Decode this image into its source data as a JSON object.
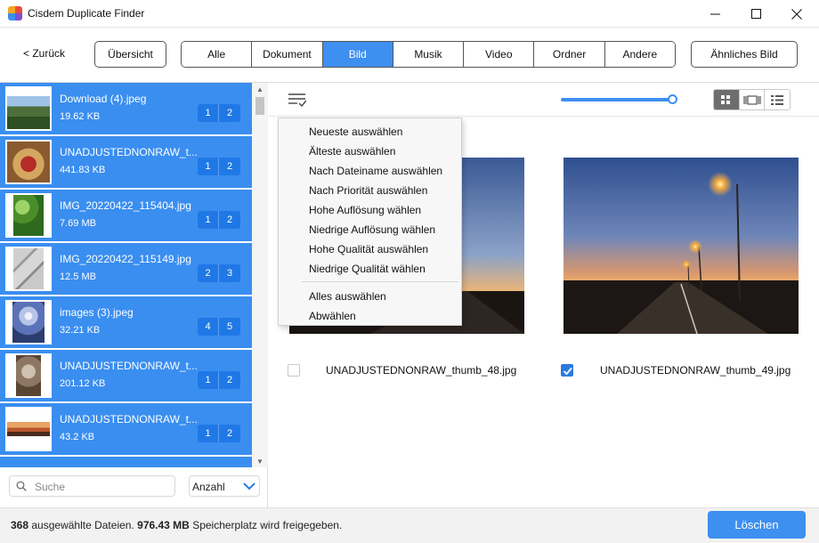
{
  "window": {
    "title": "Cisdem Duplicate Finder",
    "minimize_icon": "minimize-icon",
    "maximize_icon": "maximize-icon",
    "close_icon": "close-icon"
  },
  "toolbar": {
    "back_label": "< Zurück",
    "overview_label": "Übersicht",
    "similar_image_label": "Ähnliches Bild",
    "tabs": [
      {
        "label": "Alle"
      },
      {
        "label": "Dokument"
      },
      {
        "label": "Bild",
        "active": true
      },
      {
        "label": "Musik"
      },
      {
        "label": "Video"
      },
      {
        "label": "Ordner"
      },
      {
        "label": "Andere"
      }
    ]
  },
  "sidebar": {
    "items": [
      {
        "name": "Download (4).jpeg",
        "size": "19.62 KB",
        "counts": [
          "1",
          "2"
        ]
      },
      {
        "name": "UNADJUSTEDNONRAW_t...",
        "size": "441.83 KB",
        "counts": [
          "1",
          "2"
        ]
      },
      {
        "name": "IMG_20220422_115404.jpg",
        "size": "7.69 MB",
        "counts": [
          "1",
          "2"
        ]
      },
      {
        "name": "IMG_20220422_115149.jpg",
        "size": "12.5 MB",
        "counts": [
          "2",
          "3"
        ]
      },
      {
        "name": "images (3).jpeg",
        "size": "32.21 KB",
        "counts": [
          "4",
          "5"
        ]
      },
      {
        "name": "UNADJUSTEDNONRAW_t...",
        "size": "201.12 KB",
        "counts": [
          "1",
          "2"
        ]
      },
      {
        "name": "UNADJUSTEDNONRAW_t...",
        "size": "43.2 KB",
        "counts": [
          "1",
          "2"
        ]
      }
    ],
    "search_placeholder": "Suche",
    "sort_value": "Anzahl"
  },
  "content": {
    "zoom_fraction": 0.95,
    "view_modes": [
      "grid-view-icon",
      "filmstrip-view-icon",
      "list-view-icon"
    ],
    "active_view": "grid-view-icon",
    "files": [
      {
        "name": "UNADJUSTEDNONRAW_thumb_48.jpg",
        "checked": false
      },
      {
        "name": "UNADJUSTEDNONRAW_thumb_49.jpg",
        "checked": true
      }
    ]
  },
  "select_menu": {
    "items": [
      "Neueste auswählen",
      "Älteste auswählen",
      "Nach Dateiname auswählen",
      "Nach Priorität auswählen",
      "Hohe Auflösung wählen",
      "Niedrige Auflösung wählen",
      "Hohe Qualität auswählen",
      "Niedrige Qualität wählen"
    ],
    "select_all": "Alles auswählen",
    "deselect": "Abwählen"
  },
  "status": {
    "selected_count": "368",
    "selected_text": "ausgewählte Dateien.",
    "freed_size": "976.43 MB",
    "freed_text": "Speicherplatz wird freigegeben.",
    "delete_label": "Löschen"
  },
  "colors": {
    "accent": "#3d8ff0",
    "list_bg": "#3a8ef0",
    "count_bg": "#1f78e6"
  }
}
